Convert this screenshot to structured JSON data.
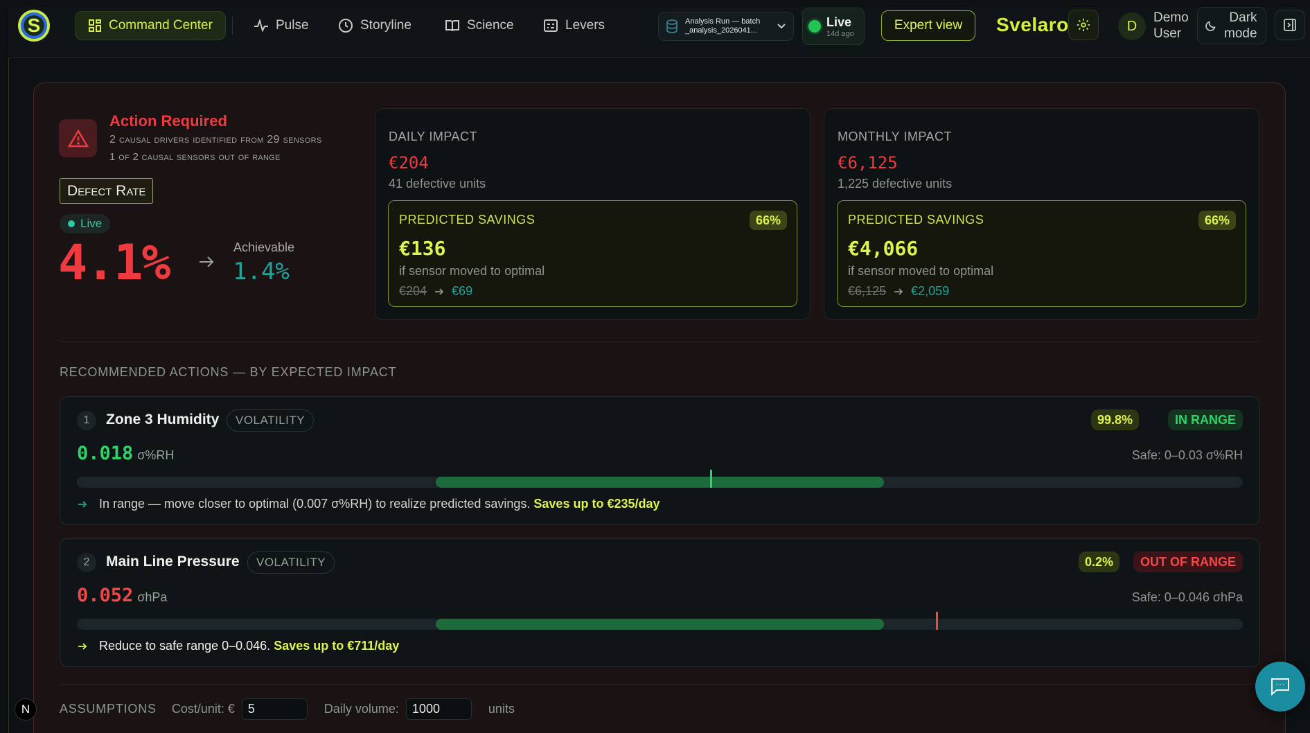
{
  "nav": {
    "logo_letter": "S",
    "items": [
      {
        "label": "Command Center",
        "icon": "grid-icon",
        "active": true
      },
      {
        "label": "Pulse",
        "icon": "pulse-icon"
      },
      {
        "label": "Storyline",
        "icon": "clock-icon"
      },
      {
        "label": "Science",
        "icon": "book-icon"
      },
      {
        "label": "Levers",
        "icon": "sliders-icon"
      }
    ],
    "run_select": {
      "line1": "Analysis Run — batch",
      "line2": "_analysis_2026041..."
    },
    "live": {
      "label": "Live",
      "sub": "14d ago"
    },
    "expert_view": "Expert view",
    "brand": "Svelaro",
    "user": {
      "initial": "D",
      "line1": "Demo",
      "line2": "User"
    },
    "dark_mode": {
      "line1": "Dark",
      "line2": "mode"
    }
  },
  "alert": {
    "title": "Action Required",
    "line1": "2 causal drivers identified from 29 sensors",
    "line2": "1 of 2 causal sensors out of range"
  },
  "metric": {
    "tag": "Defect Rate",
    "live": "Live",
    "current": "4.1%",
    "achievable_label": "Achievable",
    "achievable": "1.4%"
  },
  "impact": [
    {
      "heading": "DAILY IMPACT",
      "value": "€204",
      "units": "41 defective units",
      "savings": {
        "heading": "PREDICTED SAVINGS",
        "pct": "66%",
        "amount": "€136",
        "note": "if sensor moved to optimal",
        "from": "€204",
        "to": "€69"
      }
    },
    {
      "heading": "MONTHLY IMPACT",
      "value": "€6,125",
      "units": "1,225 defective units",
      "savings": {
        "heading": "PREDICTED SAVINGS",
        "pct": "66%",
        "amount": "€4,066",
        "note": "if sensor moved to optimal",
        "from": "€6,125",
        "to": "€2,059"
      }
    }
  ],
  "actions_title": "RECOMMENDED ACTIONS — BY EXPECTED IMPACT",
  "actions": [
    {
      "rank": "1",
      "name": "Zone 3 Humidity",
      "kind": "VOLATILITY",
      "probability": "99.8%",
      "status": "IN RANGE",
      "status_ok": true,
      "value": "0.018",
      "unit": "σ%RH",
      "safe": "Safe: 0–0.03 σ%RH",
      "value_color": "#2fd36a",
      "safe_range_fraction": [
        0.308,
        0.692
      ],
      "marker_fraction": 0.543,
      "marker_color": "#2fd36a",
      "advice": "In range — move closer to optimal (0.007 σ%RH) to realize predicted savings.",
      "highlight": "Saves up to €235/day"
    },
    {
      "rank": "2",
      "name": "Main Line Pressure",
      "kind": "VOLATILITY",
      "probability": "0.2%",
      "status": "OUT OF RANGE",
      "status_ok": false,
      "value": "0.052",
      "unit": "σhPa",
      "safe": "Safe: 0–0.046 σhPa",
      "value_color": "#f24848",
      "safe_range_fraction": [
        0.308,
        0.692
      ],
      "marker_fraction": 0.737,
      "marker_color": "#f24848",
      "advice": "Reduce to safe range 0–0.046.",
      "highlight": "Saves up to €711/day"
    }
  ],
  "assumptions": {
    "title": "ASSUMPTIONS",
    "cost_label": "Cost/unit: €",
    "cost_value": "5",
    "volume_label": "Daily volume:",
    "volume_value": "1000",
    "volume_unit": "units"
  },
  "n_badge": "N"
}
